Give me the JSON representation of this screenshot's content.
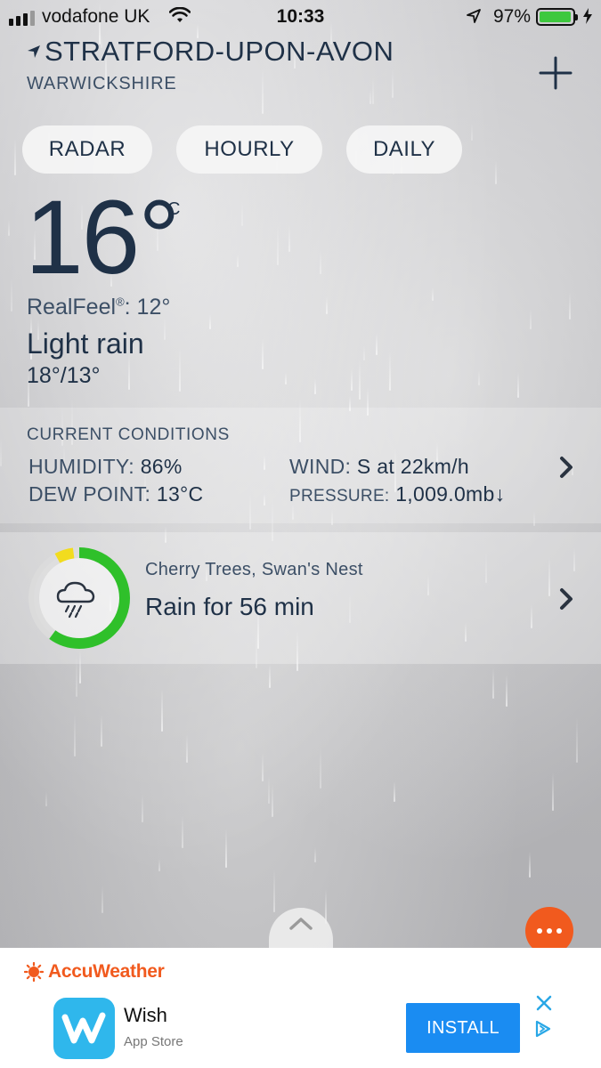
{
  "status_bar": {
    "carrier": "vodafone UK",
    "time": "10:33",
    "battery": "97%",
    "battery_level": 0.97
  },
  "header": {
    "city": "STRATFORD-UPON-AVON",
    "region": "WARWICKSHIRE"
  },
  "tabs": [
    {
      "label": "RADAR"
    },
    {
      "label": "HOURLY"
    },
    {
      "label": "DAILY"
    }
  ],
  "current": {
    "temperature": "16°",
    "unit": "C",
    "realfeel_label": "RealFeel",
    "realfeel_mark": "®",
    "realfeel_value": ": 12°",
    "phrase": "Light rain",
    "hilo": "18°/13°"
  },
  "conditions": {
    "title": "CURRENT CONDITIONS",
    "humidity_label": "HUMIDITY:",
    "humidity_value": "86%",
    "dew_label": "DEW POINT:",
    "dew_value": "13°C",
    "wind_label": "WIND:",
    "wind_value": "S at 22km/h",
    "pressure_label": "PRESSURE:",
    "pressure_value": "1,009.0mb",
    "pressure_trend": "↓"
  },
  "minutecast": {
    "location": "Cherry Trees, Swan's Nest",
    "summary": "Rain for 56 min",
    "ring_green_fraction": 0.6,
    "ring_yellow_fraction": 0.06
  },
  "ad": {
    "brand": "AccuWeather",
    "app_name": "Wish",
    "store": "App Store",
    "install_label": "INSTALL"
  },
  "colors": {
    "accent": "#f15a1e",
    "text_primary": "#1f3147",
    "install_blue": "#1a8cf2",
    "ring_green": "#2fc02a",
    "ring_yellow": "#f2dc1e"
  }
}
